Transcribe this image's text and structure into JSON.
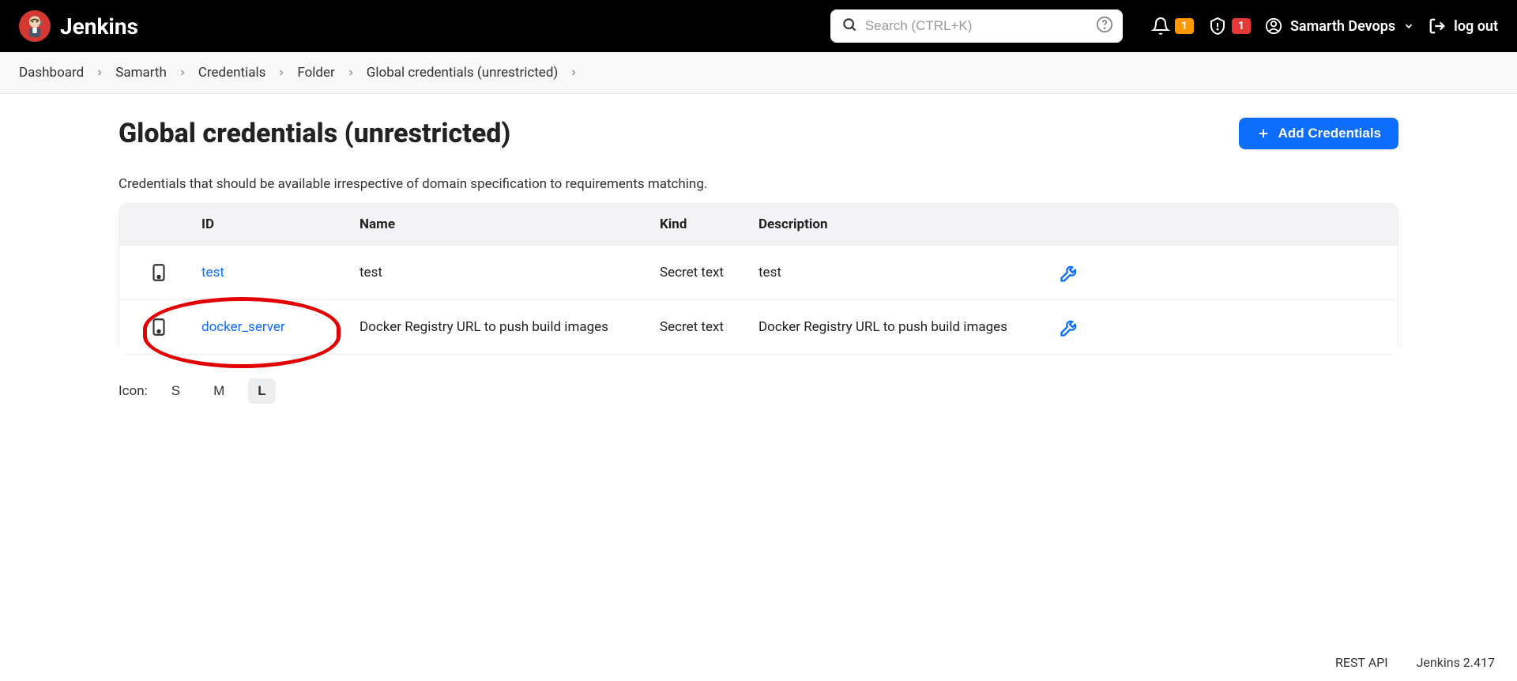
{
  "header": {
    "brand": "Jenkins",
    "search_placeholder": "Search (CTRL+K)",
    "notification_badge": "1",
    "security_badge": "1",
    "user_name": "Samarth Devops",
    "logout_label": "log out"
  },
  "breadcrumb": [
    "Dashboard",
    "Samarth",
    "Credentials",
    "Folder",
    "Global credentials (unrestricted)"
  ],
  "page": {
    "title": "Global credentials (unrestricted)",
    "add_button": "Add Credentials",
    "description": "Credentials that should be available irrespective of domain specification to requirements matching."
  },
  "table": {
    "columns": {
      "id": "ID",
      "name": "Name",
      "kind": "Kind",
      "description": "Description"
    },
    "rows": [
      {
        "id": "test",
        "name": "test",
        "kind": "Secret text",
        "description": "test"
      },
      {
        "id": "docker_server",
        "name": "Docker Registry URL to push build images",
        "kind": "Secret text",
        "description": "Docker Registry URL to push build images"
      }
    ]
  },
  "icon_size": {
    "label": "Icon:",
    "s": "S",
    "m": "M",
    "l": "L",
    "active": "L"
  },
  "footer": {
    "rest_api": "REST API",
    "version": "Jenkins 2.417"
  },
  "colors": {
    "primary": "#0D6EFD",
    "badge_orange": "#ff9800",
    "badge_red": "#e53935"
  }
}
